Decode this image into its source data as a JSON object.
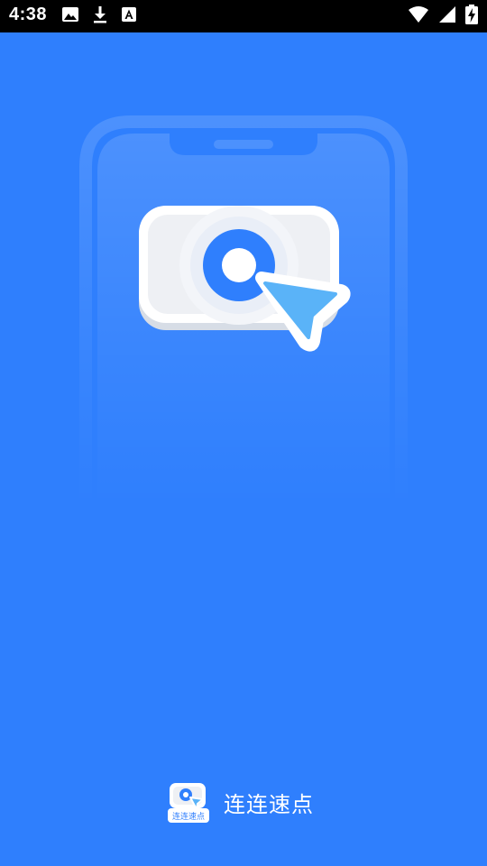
{
  "status_bar": {
    "time": "4:38",
    "left_icons": [
      "image-icon",
      "download-icon",
      "keyboard-a-icon"
    ],
    "right_icons": [
      "wifi-icon",
      "cell-signal-icon",
      "battery-charging-icon"
    ]
  },
  "splash": {
    "illustration_icon": "phone-click-target-icon"
  },
  "brand": {
    "logo_text": "连连速点",
    "app_name": "连连速点"
  },
  "colors": {
    "background": "#2f7ffd",
    "accent_light": "#5ab3f8",
    "white": "#ffffff"
  }
}
